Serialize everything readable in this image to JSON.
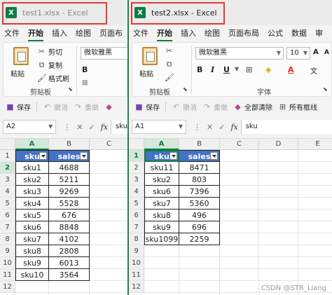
{
  "windows": [
    {
      "id": "w1",
      "app_icon_letter": "X",
      "title": "test1.xlsx  -  Excel",
      "tabs": [
        "文件",
        "开始",
        "插入",
        "绘图",
        "页面布"
      ],
      "active_tab": 1,
      "ribbon": {
        "paste": "粘贴",
        "cut": "剪切",
        "copy": "复制",
        "format_painter": "格式刷",
        "clipboard_group": "剪贴板",
        "font_name": "微软雅黑"
      },
      "qat": {
        "save": "保存",
        "undo": "撤消",
        "redo": "重做"
      },
      "name_box": "A2",
      "formula": "sku",
      "columns": [
        "A",
        "B",
        "C"
      ],
      "rows": [
        "1",
        "2",
        "3",
        "4",
        "5",
        "6",
        "7",
        "8",
        "9",
        "10",
        "11",
        "12"
      ],
      "headers": [
        "sku",
        "sales"
      ],
      "data": [
        [
          "sku1",
          "4688"
        ],
        [
          "sku2",
          "5211"
        ],
        [
          "sku3",
          "9269"
        ],
        [
          "sku4",
          "5528"
        ],
        [
          "sku5",
          "676"
        ],
        [
          "sku6",
          "8848"
        ],
        [
          "sku7",
          "4102"
        ],
        [
          "sku8",
          "2808"
        ],
        [
          "sku9",
          "6013"
        ],
        [
          "sku10",
          "3564"
        ]
      ]
    },
    {
      "id": "w2",
      "app_icon_letter": "X",
      "title": "test2.xlsx  -  Excel",
      "tabs": [
        "文件",
        "开始",
        "插入",
        "绘图",
        "页面布局",
        "公式",
        "数据",
        "审"
      ],
      "active_tab": 1,
      "ribbon": {
        "paste": "粘贴",
        "clipboard_group": "剪贴板",
        "font_name": "微软雅黑",
        "font_size": "10",
        "font_group": "字体"
      },
      "qat": {
        "save": "保存",
        "undo": "撤消",
        "redo": "重做",
        "clear_all": "全部清除",
        "all_borders": "所有框线"
      },
      "name_box": "A1",
      "formula": "sku",
      "columns": [
        "A",
        "B",
        "C",
        "D",
        "E"
      ],
      "rows": [
        "1",
        "2",
        "3",
        "4",
        "5",
        "6",
        "7",
        "8",
        "9",
        "10",
        "11",
        "12"
      ],
      "headers": [
        "sku",
        "sales"
      ],
      "data": [
        [
          "sku11",
          "8471"
        ],
        [
          "sku2",
          "803"
        ],
        [
          "sku6",
          "7396"
        ],
        [
          "sku7",
          "5360"
        ],
        [
          "sku8",
          "496"
        ],
        [
          "sku9",
          "696"
        ],
        [
          "sku1099",
          "2259"
        ]
      ]
    }
  ],
  "watermark": "CSDN @STR_Liang",
  "colors": {
    "header_fill": "#4472c4",
    "excel_green": "#107c41",
    "highlight_box": "#e53935"
  }
}
